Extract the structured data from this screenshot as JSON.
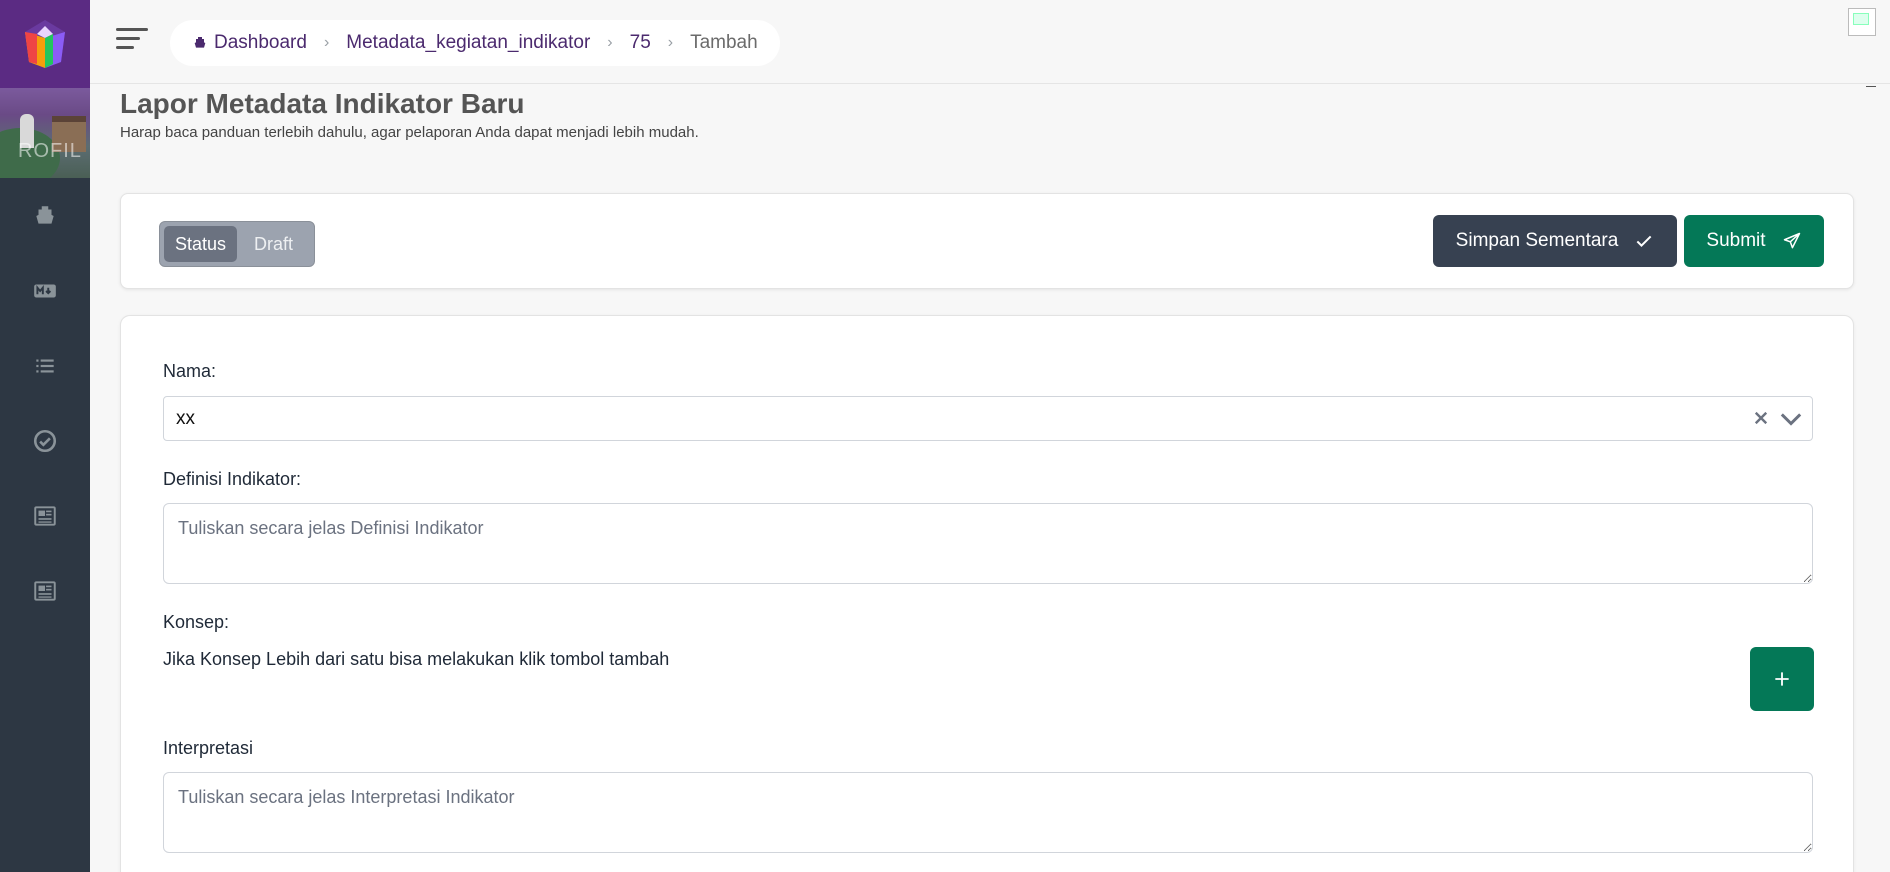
{
  "colors": {
    "sidebar_bg": "#2d3743",
    "logo_bg": "#5b2b83",
    "breadcrumb_text": "#4b2a6e",
    "primary_green": "#047857",
    "dark_button": "#374151",
    "toggle_active": "#6b7280"
  },
  "sidebar": {
    "banner_text": "ROFIL",
    "items": [
      {
        "icon": "ship-icon"
      },
      {
        "icon": "markdown-icon"
      },
      {
        "icon": "list-icon"
      },
      {
        "icon": "check-circle-icon"
      },
      {
        "icon": "newspaper-icon"
      },
      {
        "icon": "newspaper-icon"
      }
    ]
  },
  "breadcrumb": {
    "items": [
      {
        "label": "Dashboard",
        "icon": "ship-icon"
      },
      {
        "label": "Metadata_kegiatan_indikator"
      },
      {
        "label": "75"
      },
      {
        "label": "Tambah"
      }
    ]
  },
  "header": {
    "title": "Lapor Metadata Indikator Baru",
    "subtitle": "Harap baca panduan terlebih dahulu, agar pelaporan Anda dapat menjadi lebih mudah."
  },
  "status_bar": {
    "toggle": {
      "status_label": "Status",
      "draft_label": "Draft",
      "selected": "Status"
    },
    "save_label": "Simpan Sementara",
    "submit_label": "Submit"
  },
  "form": {
    "nama": {
      "label": "Nama:",
      "value": "xx"
    },
    "definisi": {
      "label": "Definisi Indikator:",
      "placeholder": "Tuliskan secara jelas Definisi Indikator"
    },
    "konsep": {
      "label": "Konsep:",
      "help": "Jika Konsep Lebih dari satu bisa melakukan klik tombol tambah",
      "add_label": "+"
    },
    "interpretasi": {
      "label": "Interpretasi",
      "placeholder": "Tuliskan secara jelas Interpretasi Indikator"
    }
  }
}
